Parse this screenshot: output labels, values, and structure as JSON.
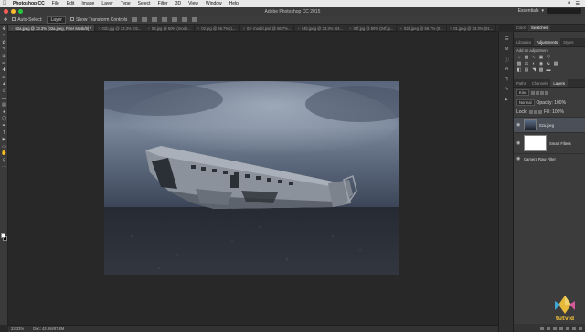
{
  "menubar": {
    "apple_glyph": "",
    "items": [
      "Photoshop CC",
      "File",
      "Edit",
      "Image",
      "Layer",
      "Type",
      "Select",
      "Filter",
      "3D",
      "View",
      "Window",
      "Help"
    ]
  },
  "window": {
    "title": "Adobe Photoshop CC 2015",
    "workspace": "Essentials"
  },
  "options_bar": {
    "auto_select_label": "Auto-Select:",
    "auto_select_value": "Layer",
    "show_transform_label": "Show Transform Controls"
  },
  "tabs": [
    {
      "label": "02a.jpeg @ 33.3% (02a.jpeg, Filter Mask/8) *",
      "active": true
    },
    {
      "label": "02b.jpg @ 33.3% (02...",
      "active": false
    },
    {
      "label": "03.jpg @ 50% (mode...",
      "active": false
    },
    {
      "label": "02.jpg @ 66.7% (L...",
      "active": false
    },
    {
      "label": "03- model.psd @ 66.7%...",
      "active": false
    },
    {
      "label": "04b.jpeg @ 33.3% (04...",
      "active": false
    },
    {
      "label": "04f.jpg @ 50% (04f.jp...",
      "active": false
    },
    {
      "label": "02d.jpeg @ 66.7% (0...",
      "active": false
    },
    {
      "label": "01.jpeg @ 33.3% (01...",
      "active": false
    }
  ],
  "status_bar": {
    "zoom": "33.33%",
    "doc": "Doc: 43.9M/87.8M"
  },
  "panels": {
    "top_tabs": [
      "Color",
      "Swatches"
    ],
    "adj_tabs": [
      "Libraries",
      "Adjustments",
      "Styles"
    ],
    "adj_heading": "Add an adjustment",
    "layer_tabs": [
      "Paths",
      "Channels",
      "Layers"
    ],
    "kind_label": "Kind",
    "blend_mode": "Normal",
    "opacity_label": "Opacity: 100%",
    "lock_label": "Lock:",
    "fill_label": "Fill: 100%",
    "layers": [
      {
        "name": "02a.jpeg",
        "type": "image"
      },
      {
        "name": "Smart Filters",
        "type": "mask"
      },
      {
        "name": "Camera Raw Filter",
        "type": "filter"
      }
    ]
  },
  "watermark": {
    "text": "tutvid"
  },
  "colors": {
    "close": "#ff5f57",
    "minimize": "#febc2e",
    "zoom": "#28c840",
    "accent_logo": "#e6b93b"
  }
}
